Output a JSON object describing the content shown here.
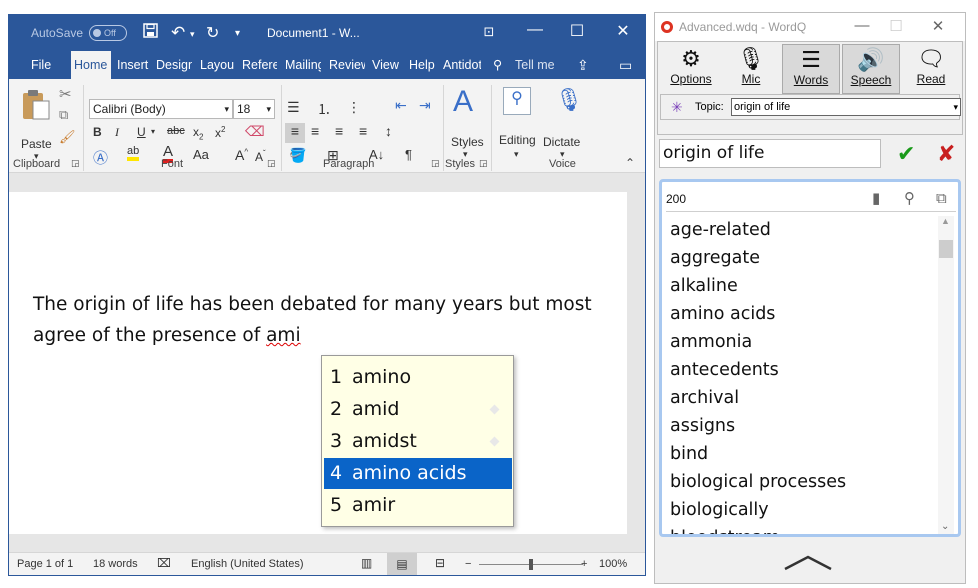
{
  "word": {
    "titlebar": {
      "autosave_label": "AutoSave",
      "autosave_state": "Off",
      "document_title": "Document1 - W..."
    },
    "tabs": [
      "File",
      "Home",
      "Insert",
      "Design",
      "Layout",
      "References",
      "Mailings",
      "Review",
      "View",
      "Help",
      "Antidote"
    ],
    "tell_me": "Tell me",
    "ribbon": {
      "clipboard": {
        "paste_label": "Paste",
        "group_label": "Clipboard"
      },
      "font": {
        "font_name": "Calibri (Body)",
        "font_size": "18",
        "group_label": "Font"
      },
      "paragraph": {
        "group_label": "Paragraph"
      },
      "styles": {
        "button_label": "Styles",
        "group_label": "Styles"
      },
      "editing": {
        "button_label": "Editing"
      },
      "voice": {
        "button_label": "Dictate",
        "group_label": "Voice"
      }
    },
    "document": {
      "text_before": "The origin of life has been debated for many years but most agree of the presence of ",
      "misspelled_word": "ami"
    },
    "suggestions": [
      {
        "num": "1",
        "word": "amino",
        "selected": false,
        "marker": false
      },
      {
        "num": "2",
        "word": "amid",
        "selected": false,
        "marker": true
      },
      {
        "num": "3",
        "word": "amidst",
        "selected": false,
        "marker": true
      },
      {
        "num": "4",
        "word": "amino acids",
        "selected": true,
        "marker": false
      },
      {
        "num": "5",
        "word": "amir",
        "selected": false,
        "marker": false
      }
    ],
    "statusbar": {
      "page": "Page 1 of 1",
      "words": "18 words",
      "language": "English (United States)",
      "zoom": "100%",
      "zoom_level": 1.0
    }
  },
  "wordq": {
    "window_title": "Advanced.wdq - WordQ",
    "toolbar": [
      {
        "label": "Options",
        "icon": "gear-icon",
        "active": false
      },
      {
        "label": "Mic",
        "icon": "mic-muted-icon",
        "active": false
      },
      {
        "label": "Words",
        "icon": "list-icon",
        "active": true
      },
      {
        "label": "Speech",
        "icon": "speaker-icon",
        "active": true
      },
      {
        "label": "Read",
        "icon": "speech-bubble-icon",
        "active": false
      }
    ],
    "topic_label": "Topic:",
    "topic_value": "origin of life",
    "search_value": "origin of life",
    "word_count": "200",
    "words": [
      "age-related",
      "aggregate",
      "alkaline",
      "amino acids",
      "ammonia",
      "antecedents",
      "archival",
      "assigns",
      "bind",
      "biological processes",
      "biologically",
      "bloodstream"
    ],
    "colors": {
      "accent": "#2b579a",
      "selection": "#0a64c8",
      "check": "#1a9a1a",
      "cross": "#c81e1e"
    }
  }
}
